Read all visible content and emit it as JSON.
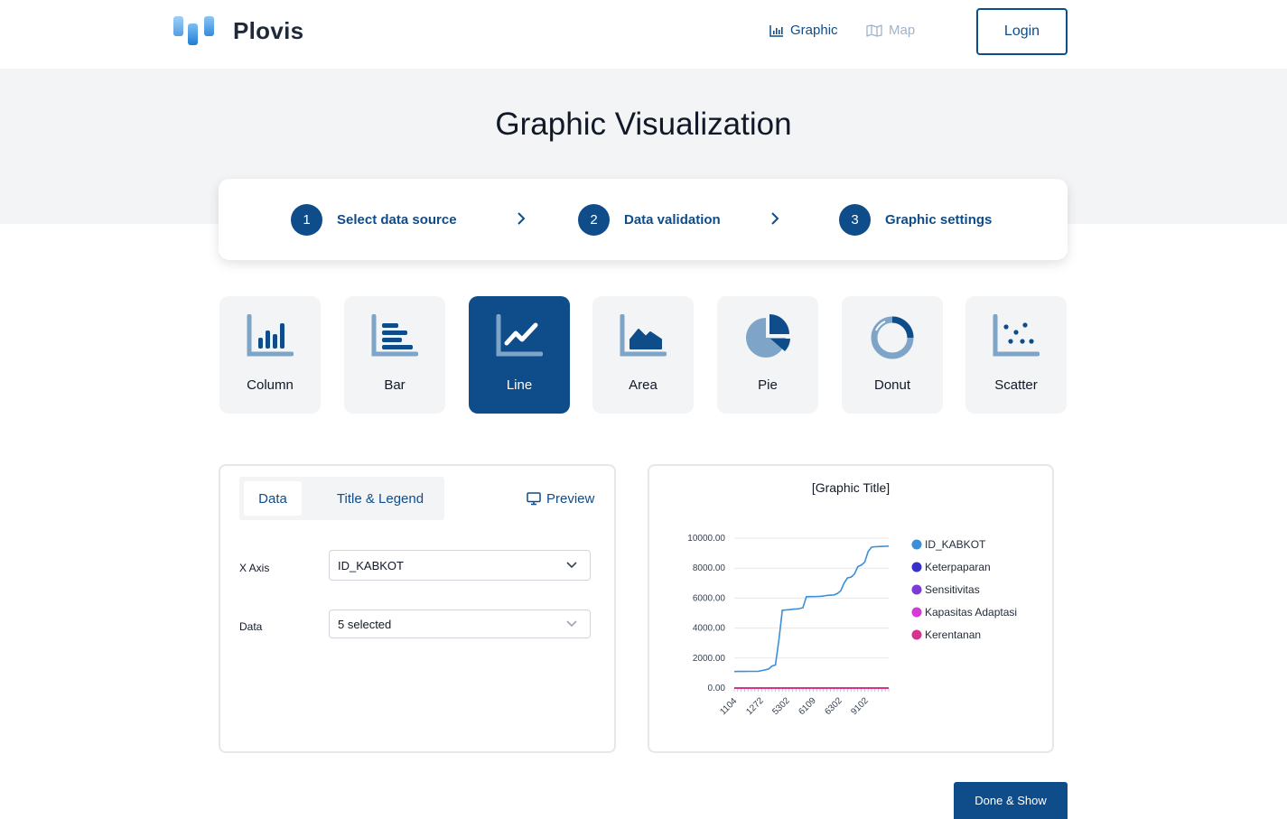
{
  "brand": {
    "name": "Plovis"
  },
  "nav": {
    "graphic": "Graphic",
    "map": "Map",
    "login": "Login"
  },
  "page_title": "Graphic Visualization",
  "steps": [
    {
      "num": "1",
      "label": "Select data source"
    },
    {
      "num": "2",
      "label": "Data validation"
    },
    {
      "num": "3",
      "label": "Graphic settings"
    }
  ],
  "chart_types": [
    {
      "label": "Column",
      "icon": "column-chart-icon",
      "active": false
    },
    {
      "label": "Bar",
      "icon": "bar-chart-icon",
      "active": false
    },
    {
      "label": "Line",
      "icon": "line-chart-icon",
      "active": true
    },
    {
      "label": "Area",
      "icon": "area-chart-icon",
      "active": false
    },
    {
      "label": "Pie",
      "icon": "pie-chart-icon",
      "active": false
    },
    {
      "label": "Donut",
      "icon": "donut-chart-icon",
      "active": false
    },
    {
      "label": "Scatter",
      "icon": "scatter-chart-icon",
      "active": false
    }
  ],
  "settings": {
    "tabs": {
      "data": "Data",
      "title_legend": "Title & Legend"
    },
    "preview": "Preview",
    "x_axis_label": "X Axis",
    "x_axis_value": "ID_KABKOT",
    "data_label": "Data",
    "data_value": "5 selected"
  },
  "colors": {
    "primary": "#0f4c8a",
    "band": "#f3f4f6"
  },
  "chart_data": {
    "type": "line",
    "title": "[Graphic Title]",
    "x_tick_labels": [
      "1104",
      "1272",
      "5302",
      "6109",
      "6302",
      "9102"
    ],
    "y_ticks": [
      "10000.00",
      "8000.00",
      "6000.00",
      "4000.00",
      "2000.00",
      "0.00"
    ],
    "ylim": [
      0,
      10000
    ],
    "legend_position": "right",
    "series": [
      {
        "name": "ID_KABKOT",
        "color": "#3b8fd9",
        "values": [
          1104,
          1106,
          1108,
          1110,
          1112,
          1114,
          1116,
          1118,
          1171,
          1210,
          1272,
          1470,
          1540,
          3200,
          5190,
          5210,
          5230,
          5260,
          5280,
          5302,
          5360,
          6090,
          6100,
          6105,
          6109,
          6120,
          6140,
          6180,
          6200,
          6210,
          6302,
          6480,
          7000,
          7350,
          7400,
          7600,
          8100,
          8200,
          8400,
          9102,
          9400,
          9430,
          9440,
          9450,
          9460,
          9471
        ]
      },
      {
        "name": "Keterpaparan",
        "color": "#3730c9",
        "values": [
          1,
          1
        ]
      },
      {
        "name": "Sensitivitas",
        "color": "#7c3ad6",
        "values": [
          1,
          1
        ]
      },
      {
        "name": "Kapasitas Adaptasi",
        "color": "#d43ad4",
        "values": [
          1,
          1
        ]
      },
      {
        "name": "Kerentanan",
        "color": "#d6338f",
        "values": [
          1,
          1
        ]
      }
    ]
  },
  "done_button": "Done & Show"
}
